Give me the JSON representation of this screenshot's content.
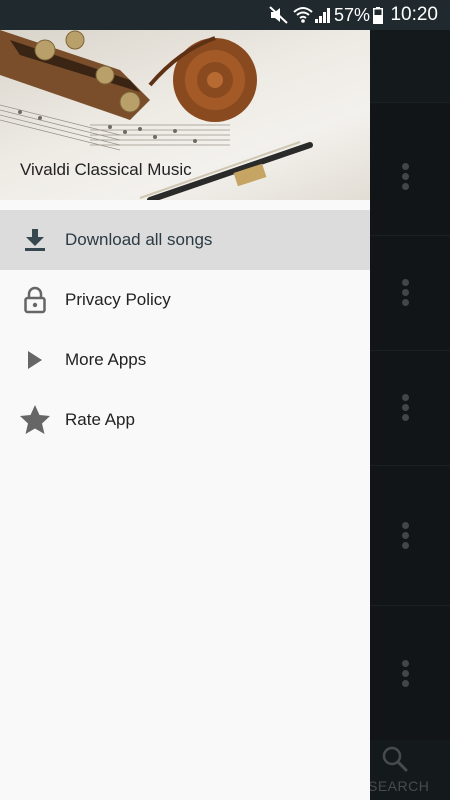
{
  "status_bar": {
    "battery_percent": "57%",
    "time": "10:20"
  },
  "drawer": {
    "header_title": "Vivaldi Classical Music",
    "items": [
      {
        "label": "Download all songs",
        "icon": "download-icon"
      },
      {
        "label": "Privacy Policy",
        "icon": "lock-icon"
      },
      {
        "label": "More Apps",
        "icon": "play-icon"
      },
      {
        "label": "Rate App",
        "icon": "star-icon"
      }
    ]
  },
  "background": {
    "search_label": "SEARCH"
  },
  "colors": {
    "status_bar": "#20292e",
    "drawer_bg": "#f9f9f9",
    "active_item_bg": "#dcdcdc",
    "icon_gray": "#666666",
    "download_icon": "#37474f"
  }
}
